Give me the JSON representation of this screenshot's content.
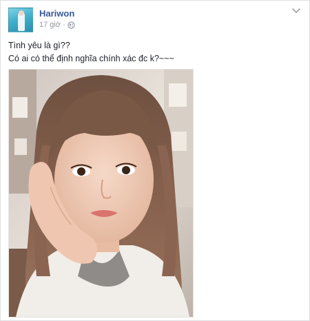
{
  "post": {
    "author": "Hariwon",
    "timestamp": "17 giờ",
    "separator": "·",
    "privacy_icon": "globe-icon",
    "menu_icon": "chevron-down-icon",
    "status_lines": [
      "Tình yêu là gì??",
      "Có ai có thể định nghĩa chính xác đc k?~~~"
    ],
    "photo": {
      "subject": "selfie"
    }
  },
  "colors": {
    "author_link": "#365899",
    "meta_text": "#90949c",
    "body_text": "#1d2129",
    "border": "#dddfe2"
  }
}
